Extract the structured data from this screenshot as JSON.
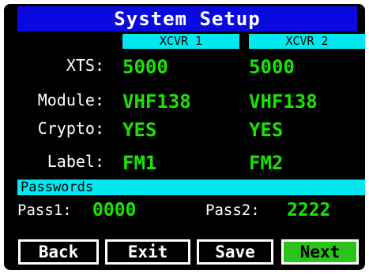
{
  "window": {
    "title": "System Setup"
  },
  "columns": {
    "xcvr1": "XCVR 1",
    "xcvr2": "XCVR 2"
  },
  "rows": [
    {
      "label": "XTS:",
      "xcvr1": "5000",
      "xcvr2": "5000"
    },
    {
      "label": "Module:",
      "xcvr1": "VHF138",
      "xcvr2": "VHF138"
    },
    {
      "label": "Crypto:",
      "xcvr1": "YES",
      "xcvr2": "YES"
    },
    {
      "label": "Label:",
      "xcvr1": "FM1",
      "xcvr2": "FM2"
    }
  ],
  "passwords": {
    "section_title": "Passwords",
    "pass1_label": "Pass1:",
    "pass1_value": "0000",
    "pass2_label": "Pass2:",
    "pass2_value": "2222"
  },
  "buttons": {
    "back": "Back",
    "exit": "Exit",
    "save": "Save",
    "next": "Next"
  },
  "colors": {
    "background": "#000000",
    "title_bar": "#0a0ae0",
    "header_cyan": "#00e8f0",
    "value_green": "#17e600",
    "next_button": "#2ac31a"
  }
}
